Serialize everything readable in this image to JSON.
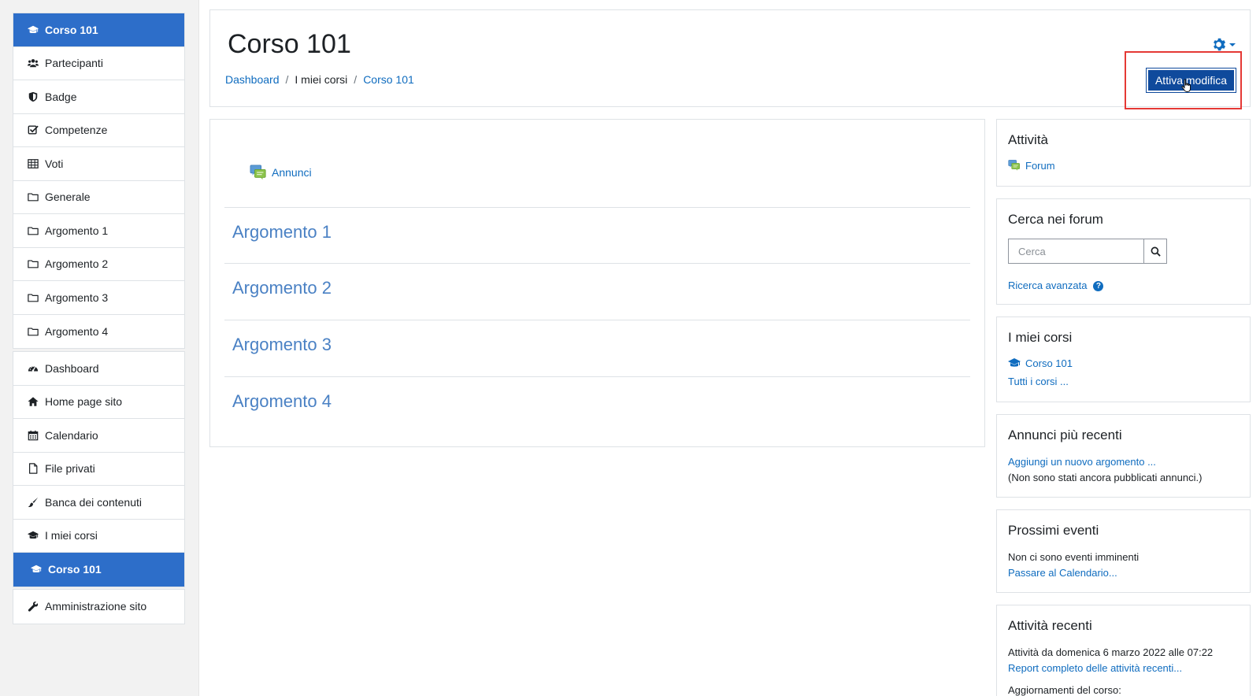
{
  "sidebar": {
    "course_nav": [
      {
        "label": "Corso 101",
        "icon": "graduation-cap-icon",
        "active": true
      },
      {
        "label": "Partecipanti",
        "icon": "users-icon"
      },
      {
        "label": "Badge",
        "icon": "shield-icon"
      },
      {
        "label": "Competenze",
        "icon": "check-square-icon"
      },
      {
        "label": "Voti",
        "icon": "table-icon"
      },
      {
        "label": "Generale",
        "icon": "folder-icon"
      },
      {
        "label": "Argomento 1",
        "icon": "folder-icon"
      },
      {
        "label": "Argomento 2",
        "icon": "folder-icon"
      },
      {
        "label": "Argomento 3",
        "icon": "folder-icon"
      },
      {
        "label": "Argomento 4",
        "icon": "folder-icon"
      }
    ],
    "site_nav": [
      {
        "label": "Dashboard",
        "icon": "tachometer-icon"
      },
      {
        "label": "Home page sito",
        "icon": "home-icon"
      },
      {
        "label": "Calendario",
        "icon": "calendar-icon"
      },
      {
        "label": "File privati",
        "icon": "file-icon"
      },
      {
        "label": "Banca dei contenuti",
        "icon": "paint-brush-icon"
      },
      {
        "label": "I miei corsi",
        "icon": "graduation-cap-icon"
      },
      {
        "label": "Corso 101",
        "icon": "graduation-cap-icon",
        "active": true
      }
    ],
    "admin_nav": [
      {
        "label": "Amministrazione sito",
        "icon": "wrench-icon"
      }
    ]
  },
  "header": {
    "title": "Corso 101",
    "breadcrumb": [
      "Dashboard",
      "I miei corsi",
      "Corso 101"
    ],
    "edit_button": "Attiva modifica"
  },
  "main": {
    "announcements_label": "Annunci",
    "topics": [
      "Argomento 1",
      "Argomento 2",
      "Argomento 3",
      "Argomento 4"
    ]
  },
  "blocks": {
    "activities": {
      "title": "Attività",
      "forum_label": "Forum"
    },
    "search_forums": {
      "title": "Cerca nei forum",
      "placeholder": "Cerca",
      "advanced_label": "Ricerca avanzata"
    },
    "my_courses": {
      "title": "I miei corsi",
      "course_label": "Corso 101",
      "all_courses": "Tutti i corsi ..."
    },
    "latest_news": {
      "title": "Annunci più recenti",
      "add_topic": "Aggiungi un nuovo argomento ...",
      "empty": "(Non sono stati ancora pubblicati annunci.)"
    },
    "upcoming_events": {
      "title": "Prossimi eventi",
      "empty": "Non ci sono eventi imminenti",
      "calendar_link": "Passare al Calendario..."
    },
    "recent_activity": {
      "title": "Attività recenti",
      "since": "Attività da domenica 6 marzo 2022 alle 07:22",
      "full_report": "Report completo delle attività recenti...",
      "updates": "Aggiornamenti del corso:"
    }
  },
  "colors": {
    "accent": "#2d6ec9",
    "link": "#0f6cbf",
    "button": "#0f4a9c",
    "highlight": "#e53935"
  }
}
